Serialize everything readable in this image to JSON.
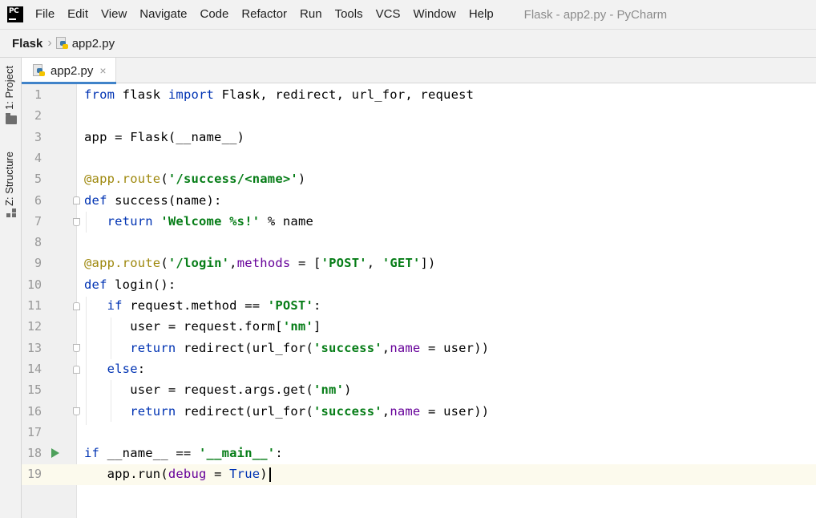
{
  "window": {
    "title": "Flask - app2.py - PyCharm",
    "menu": [
      "File",
      "Edit",
      "View",
      "Navigate",
      "Code",
      "Refactor",
      "Run",
      "Tools",
      "VCS",
      "Window",
      "Help"
    ]
  },
  "breadcrumb": {
    "project": "Flask",
    "file": "app2.py"
  },
  "tool_windows": {
    "project_label": "1: Project",
    "structure_label": "Z: Structure"
  },
  "editor": {
    "tab_label": "app2.py",
    "close_glyph": "×",
    "line_numbers": [
      "1",
      "2",
      "3",
      "4",
      "5",
      "6",
      "7",
      "8",
      "9",
      "10",
      "11",
      "12",
      "13",
      "14",
      "15",
      "16",
      "17",
      "18",
      "19"
    ],
    "lines": [
      "from flask import Flask, redirect, url_for, request",
      "",
      "app = Flask(__name__)",
      "",
      "@app.route('/success/<name>')",
      "def success(name):",
      "   return 'Welcome %s!' % name",
      "",
      "@app.route('/login',methods = ['POST', 'GET'])",
      "def login():",
      "   if request.method == 'POST':",
      "      user = request.form['nm']",
      "      return redirect(url_for('success',name = user))",
      "   else:",
      "      user = request.args.get('nm')",
      "      return redirect(url_for('success',name = user))",
      "",
      "if __name__ == '__main__':",
      "   app.run(debug = True)"
    ],
    "current_line": 19
  },
  "colors": {
    "keyword": "#0033b3",
    "string": "#067d17",
    "decorator": "#9e880d",
    "parameter": "#660099",
    "caret_line": "#fcfaed",
    "run_icon": "#4da05b"
  }
}
